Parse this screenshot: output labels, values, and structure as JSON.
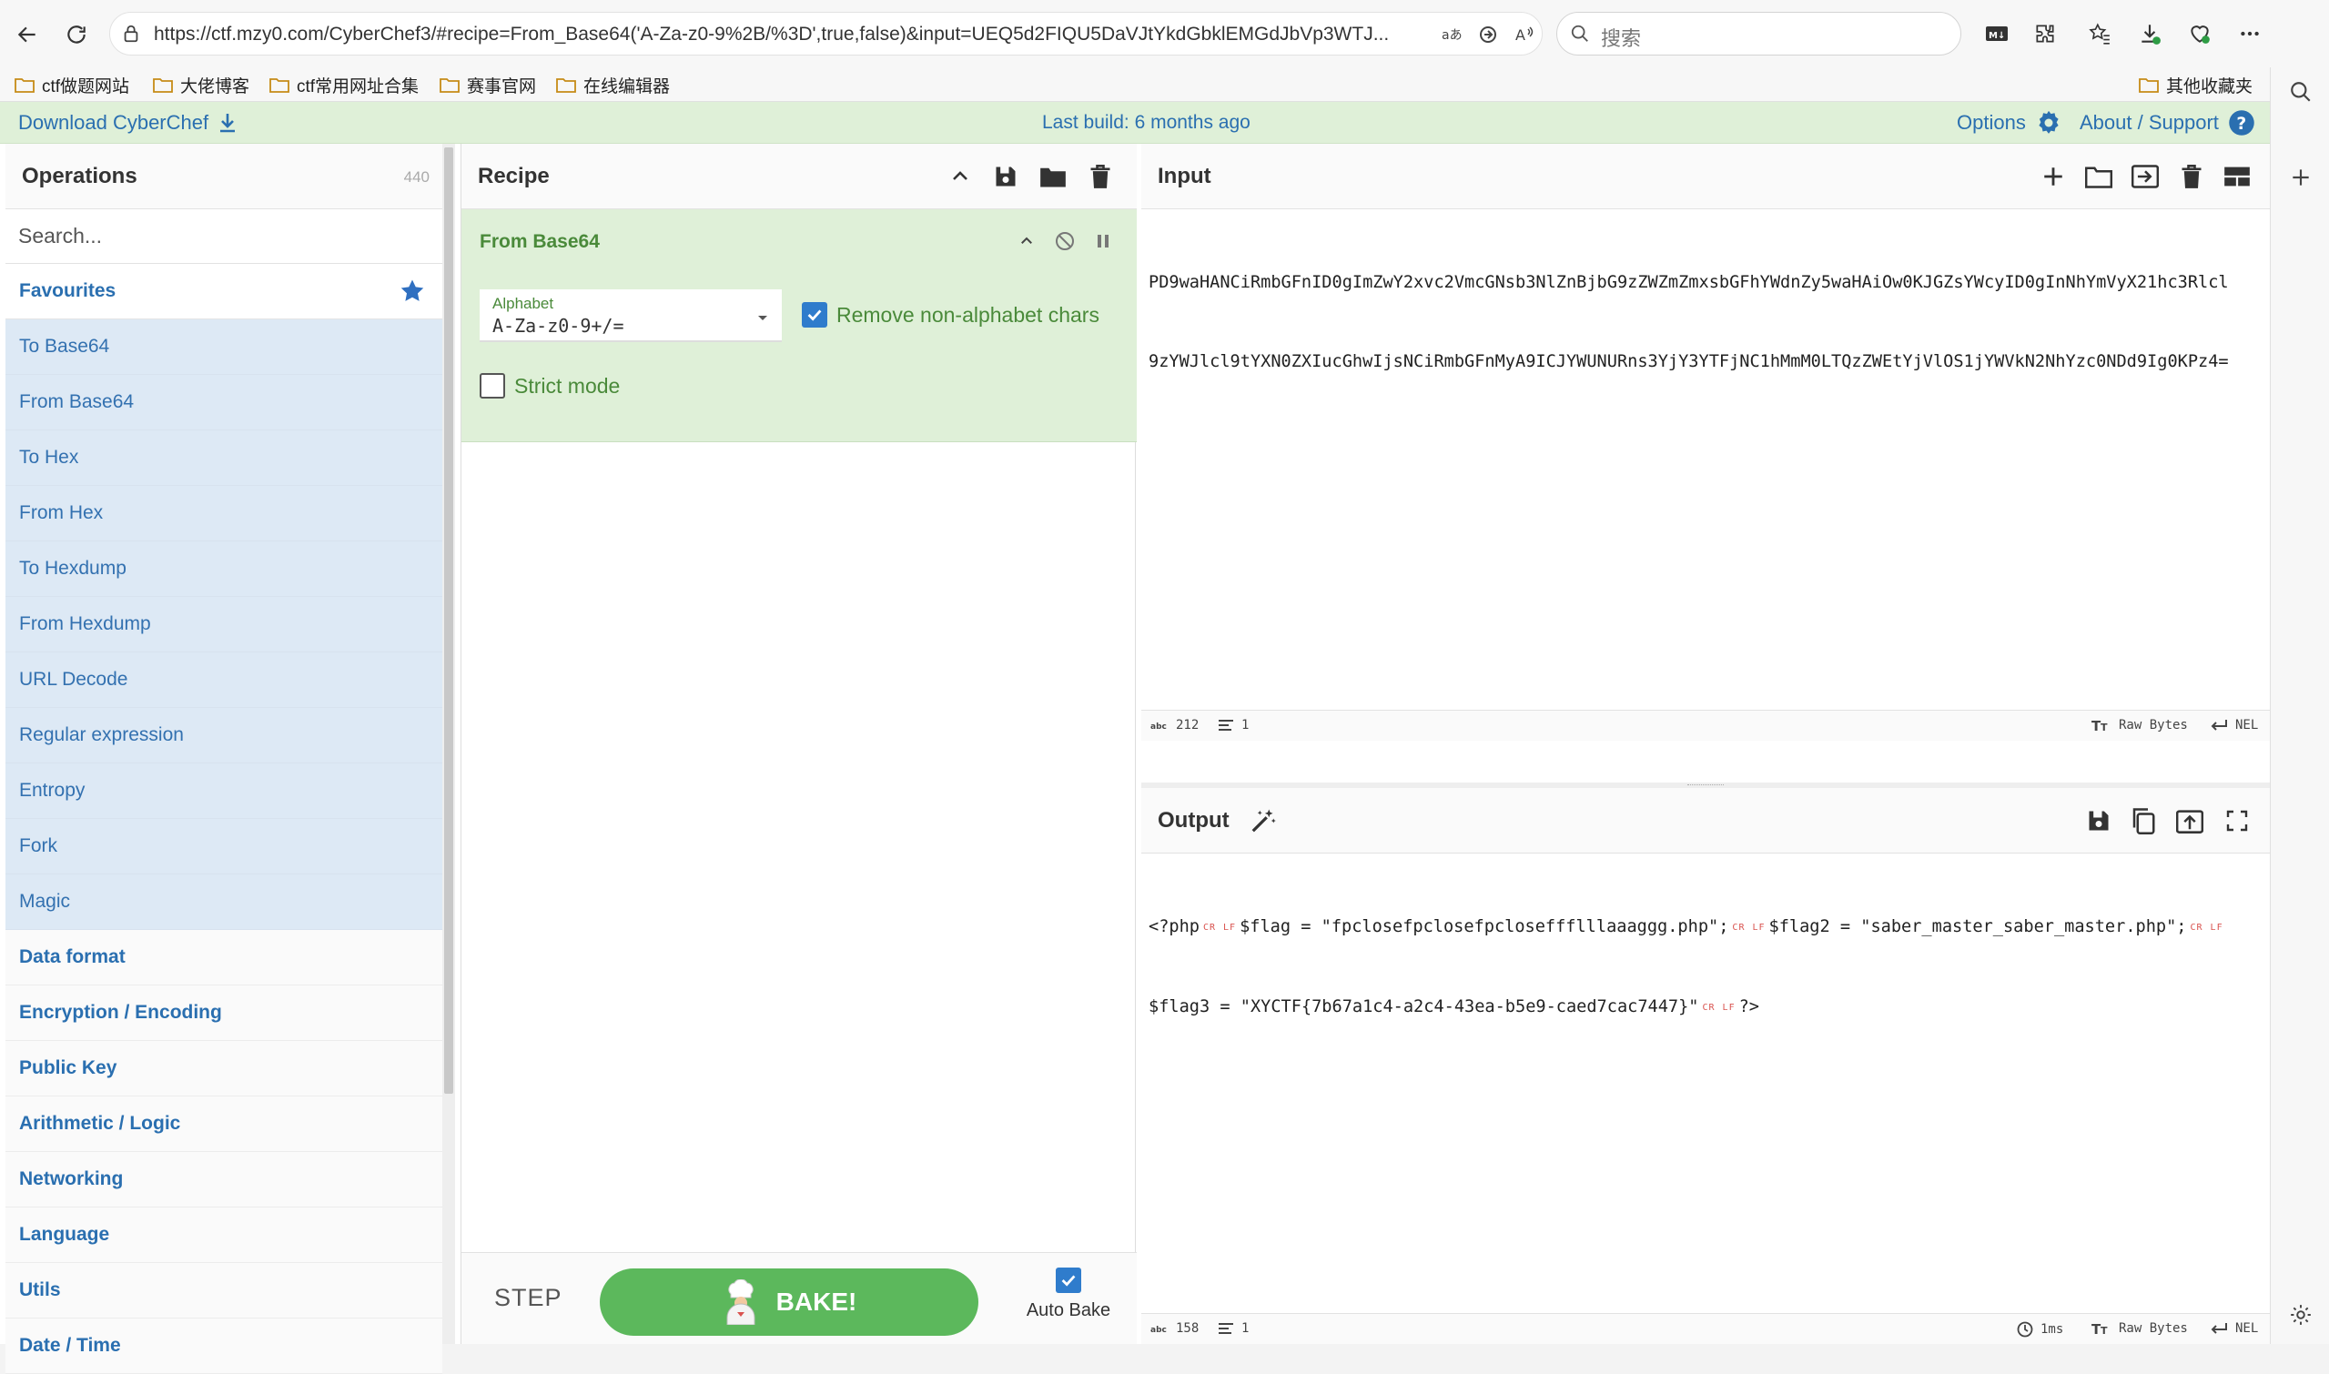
{
  "browser": {
    "url": "https://ctf.mzy0.com/CyberChef3/#recipe=From_Base64('A-Za-z0-9%2B/%3D',true,false)&input=UEQ5d2FIQU5DaVJtYkdGbklEMGdJbVp3WTJ...",
    "search_placeholder": "搜索",
    "bookmarks": [
      "ctf做题网站",
      "大佬博客",
      "ctf常用网址合集",
      "赛事官网",
      "在线编辑器"
    ],
    "other_bookmarks": "其他收藏夹"
  },
  "banner": {
    "download": "Download CyberChef",
    "build": "Last build: 6 months ago",
    "options": "Options",
    "about": "About / Support"
  },
  "operations": {
    "title": "Operations",
    "count": "440",
    "search_placeholder": "Search...",
    "favourites_label": "Favourites",
    "favourites": [
      "To Base64",
      "From Base64",
      "To Hex",
      "From Hex",
      "To Hexdump",
      "From Hexdump",
      "URL Decode",
      "Regular expression",
      "Entropy",
      "Fork",
      "Magic"
    ],
    "categories": [
      "Data format",
      "Encryption / Encoding",
      "Public Key",
      "Arithmetic / Logic",
      "Networking",
      "Language",
      "Utils",
      "Date / Time"
    ]
  },
  "recipe": {
    "title": "Recipe",
    "op_name": "From Base64",
    "alphabet_label": "Alphabet",
    "alphabet_value": "A-Za-z0-9+/=",
    "remove_non_alpha_label": "Remove non-alphabet chars",
    "remove_non_alpha_checked": true,
    "strict_mode_label": "Strict mode",
    "strict_mode_checked": false,
    "step_label": "STEP",
    "bake_label": "BAKE!",
    "autobake_label": "Auto Bake",
    "autobake_checked": true
  },
  "input": {
    "title": "Input",
    "line1": "PD9waHANCiRmbGFnID0gImZwY2xvc2VmcGNsb3NlZnBjbG9zZWZmZmxsbGFhYWdnZy5waHAiOw0KJGZsYWcyID0gInNhYmVyX21hc3Rlcl",
    "line2": "9zYWJlcl9tYXN0ZXIucGhwIjsNCiRmbGFnMyA9ICJYWUNURns3YjY3YTFjNC1hMmM0LTQzZWEtYjVlOS1jYWVkN2NhYzc0NDd9Ig0KPz4=",
    "length": "212",
    "lines": "1",
    "encoding": "Raw Bytes",
    "eol": "NEL"
  },
  "output": {
    "title": "Output",
    "p1": "<?php",
    "p2": "$flag = \"fpclosefpclosefpcloseffflllaaaggg.php\";",
    "p3": "$flag2 = \"saber_master_saber_master.php\";",
    "p4": "$flag3 = \"XYCTF{7b67a1c4-a2c4-43ea-b5e9-caed7cac7447}\"",
    "p5": "?>",
    "ctrl_cr": "CR",
    "ctrl_lf": "LF",
    "length": "158",
    "lines": "1",
    "time": "1ms",
    "encoding": "Raw Bytes",
    "eol": "NEL"
  },
  "colors": {
    "accent": "#2a6fb0",
    "recipe_green": "#dff0d8",
    "bake_green": "#5cb85c",
    "favourite_bg": "#dde9f5"
  }
}
